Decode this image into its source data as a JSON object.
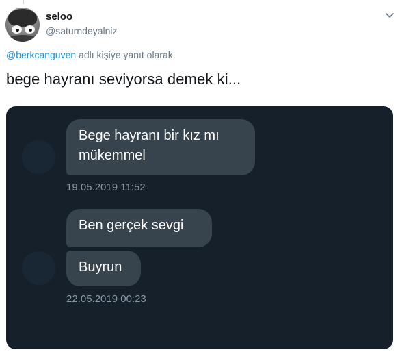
{
  "tweet": {
    "author": {
      "display_name": "seloo",
      "handle": "@saturndeyalniz"
    },
    "reply_context": {
      "mention": "@berkcanguven",
      "suffix": " adlı kişiye yanıt olarak"
    },
    "text": "bege hayranı seviyorsa demek ki...",
    "menu_icon": "chevron-down-icon"
  },
  "media": {
    "conversation": [
      {
        "messages": [
          "Bege hayranı bir kız mı",
          "mükemmel"
        ],
        "timestamp": "19.05.2019 11:52"
      },
      {
        "messages": [
          "Ben gerçek sevgi",
          "Buyrun"
        ],
        "timestamp": "22.05.2019 00:23"
      }
    ]
  },
  "colors": {
    "chat_background": "#15202b",
    "bubble": "#38444d",
    "mention": "#1b95e0",
    "muted": "#657786"
  }
}
